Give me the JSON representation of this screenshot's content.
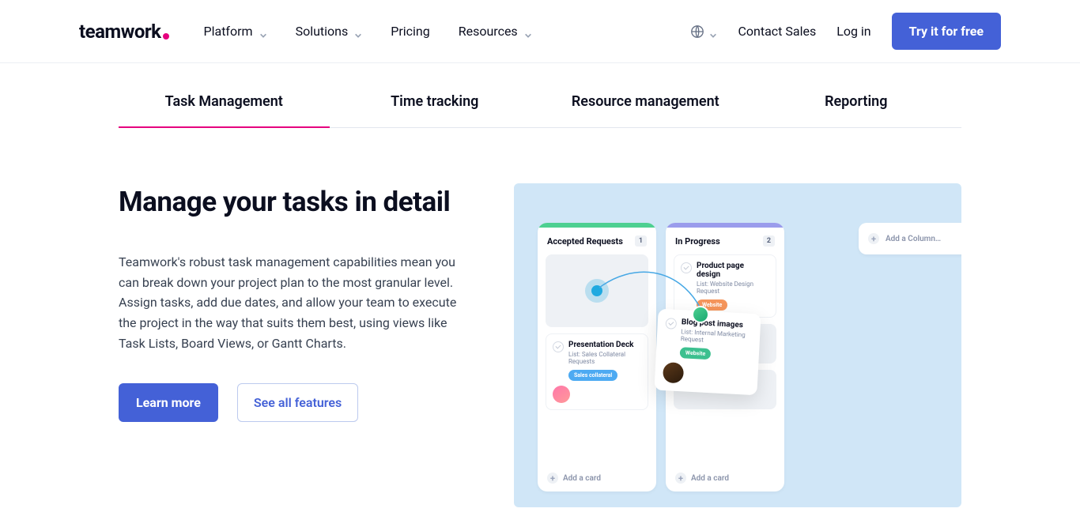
{
  "header": {
    "logo": "teamwork",
    "nav": [
      {
        "label": "Platform",
        "hasDropdown": true
      },
      {
        "label": "Solutions",
        "hasDropdown": true
      },
      {
        "label": "Pricing",
        "hasDropdown": false
      },
      {
        "label": "Resources",
        "hasDropdown": true
      }
    ],
    "contact": "Contact Sales",
    "login": "Log in",
    "cta": "Try it for free"
  },
  "tabs": [
    {
      "label": "Task Management",
      "active": true
    },
    {
      "label": "Time tracking",
      "active": false
    },
    {
      "label": "Resource management",
      "active": false
    },
    {
      "label": "Reporting",
      "active": false
    }
  ],
  "section": {
    "heading": "Manage your tasks in detail",
    "body": "Teamwork's robust task management capabilities mean you can break down your project plan to the most granular level. Assign tasks, add due dates, and allow your team to execute the project in the way that suits them best, using views like Task Lists, Board Views, or Gantt Charts.",
    "learn": "Learn more",
    "seeAll": "See all features"
  },
  "board": {
    "col1": {
      "title": "Accepted Requests",
      "count": "1",
      "card1": {
        "title": "Presentation Deck",
        "subtitle": "List: Sales Collateral Requests",
        "pill": "Sales collateral"
      },
      "add": "Add a card"
    },
    "col2": {
      "title": "In Progress",
      "count": "2",
      "card1": {
        "title": "Product page design",
        "subtitle": "List: Website Design Request",
        "pill": "Website"
      },
      "add": "Add a card"
    },
    "floating": {
      "title": "Blog post images",
      "subtitle": "List: Internal Marketing Request",
      "pill": "Website"
    },
    "addColumn": "Add a Column…"
  }
}
